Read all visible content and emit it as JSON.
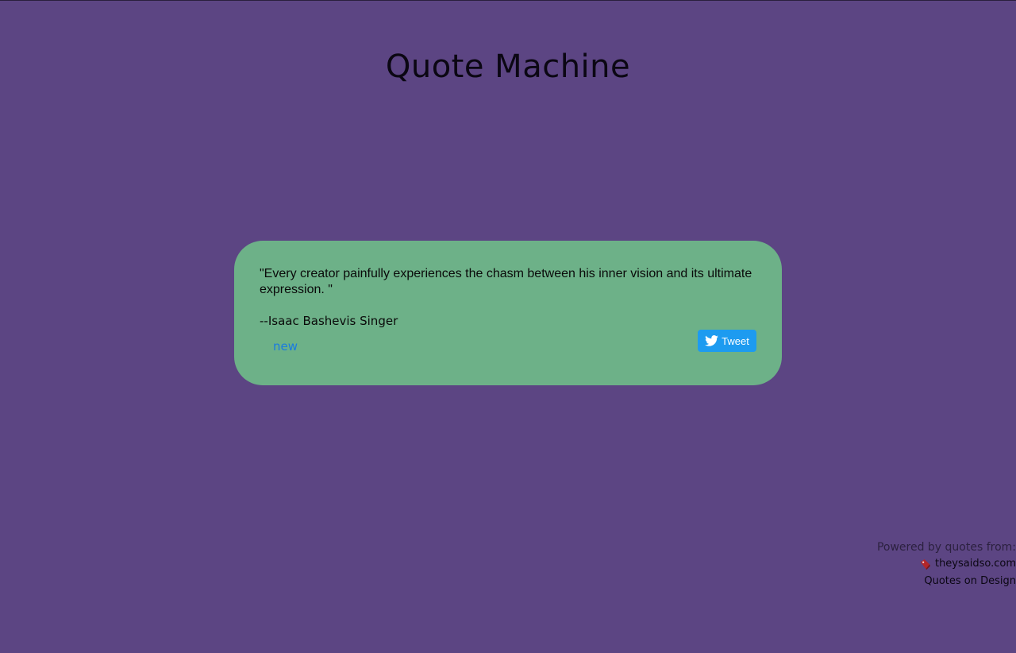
{
  "page": {
    "title": "Quote Machine"
  },
  "quote": {
    "text": "\"Every creator painfully experiences the chasm between his inner vision and its ultimate expression. \"",
    "author": "--Isaac Bashevis Singer",
    "new_label": "new",
    "tweet_label": "Tweet"
  },
  "footer": {
    "powered_label": "Powered by quotes from:",
    "source_one": "theysaidso.com",
    "source_two": "Quotes on Design"
  },
  "colors": {
    "background": "#5c4583",
    "card": "#6db188",
    "tweet": "#1d9bf0",
    "link": "#1a7be0"
  },
  "icons": {
    "tweet": "twitter-bird-icon",
    "source": "tag-icon"
  }
}
